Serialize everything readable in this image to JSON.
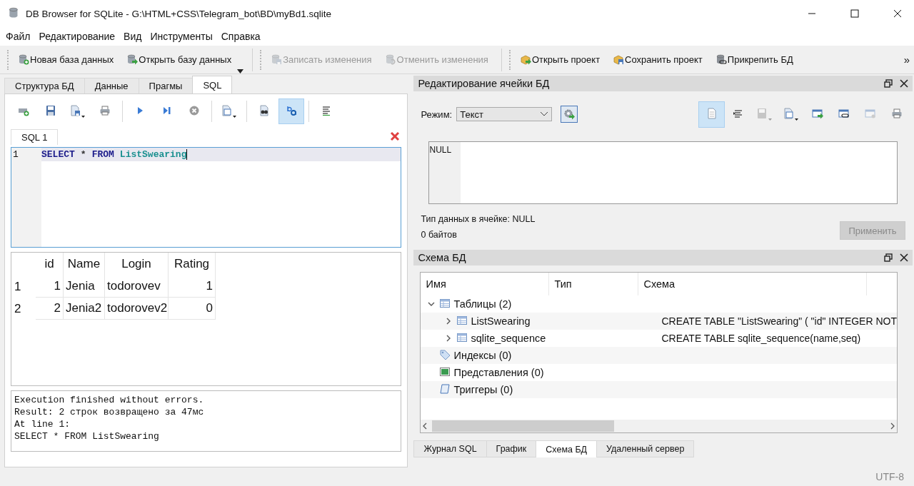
{
  "window": {
    "title": "DB Browser for SQLite - G:\\HTML+CSS\\Telegram_bot\\BD\\myBd1.sqlite"
  },
  "menu": [
    "Файл",
    "Редактирование",
    "Вид",
    "Инструменты",
    "Справка"
  ],
  "toolbar": {
    "buttons": [
      {
        "kind": "db_new",
        "label": "Новая база данных",
        "disabled": false
      },
      {
        "kind": "db_open",
        "label": "Открыть базу данных",
        "disabled": false,
        "dropdown": true
      },
      {
        "kind": "db_write",
        "label": "Записать изменения",
        "disabled": true
      },
      {
        "kind": "db_revert",
        "label": "Отменить изменения",
        "disabled": true
      },
      {
        "kind": "project_open",
        "label": "Открыть проект",
        "disabled": false
      },
      {
        "kind": "project_save",
        "label": "Сохранить проект",
        "disabled": false
      },
      {
        "kind": "db_attach",
        "label": "Прикрепить БД",
        "disabled": false
      }
    ],
    "overflow": "»"
  },
  "left_tabs": [
    {
      "label": "Структура БД",
      "selected": false
    },
    {
      "label": "Данные",
      "selected": false
    },
    {
      "label": "Прагмы",
      "selected": false
    },
    {
      "label": "SQL",
      "selected": true
    }
  ],
  "sql_toolbar": [
    {
      "kind": "tab_new",
      "checked": false
    },
    {
      "kind": "save",
      "checked": false
    },
    {
      "kind": "save_menu",
      "checked": false
    },
    {
      "kind": "print",
      "checked": false
    },
    {
      "kind": "run",
      "checked": false
    },
    {
      "kind": "run_line",
      "checked": false
    },
    {
      "kind": "stop",
      "checked": false
    },
    {
      "kind": "export",
      "checked": false
    },
    {
      "kind": "find",
      "checked": false
    },
    {
      "kind": "replace",
      "checked": true
    },
    {
      "kind": "comment",
      "checked": false
    }
  ],
  "editor_tabs": [
    {
      "label": "SQL 1",
      "selected": true
    }
  ],
  "editor": {
    "lines": [
      {
        "number": "1",
        "tokens": [
          {
            "text": "SELECT",
            "kind": "keyword"
          },
          {
            "text": "*",
            "kind": "operator"
          },
          {
            "text": "FROM",
            "kind": "keyword"
          },
          {
            "text": "ListSwearing",
            "kind": "identifier"
          }
        ]
      }
    ]
  },
  "results": {
    "columns": [
      "id",
      "Name",
      "Login",
      "Rating"
    ],
    "rows": [
      {
        "header": "1",
        "cells": [
          "1",
          "Jenia",
          "todorovev",
          "1"
        ]
      },
      {
        "header": "2",
        "cells": [
          "2",
          "Jenia2",
          "todorovev2",
          "0"
        ]
      }
    ]
  },
  "message": [
    "Execution finished without errors.",
    "Result: 2 строк возвращено за 47мс",
    "At line 1:",
    "SELECT * FROM ListSwearing"
  ],
  "cell_editor": {
    "title": "Редактирование ячейки БД",
    "mode_label": "Режим:",
    "mode_value": "Текст",
    "buttons": [
      {
        "kind": "text",
        "checked": true,
        "disabled": false
      },
      {
        "kind": "indent",
        "checked": false,
        "disabled": false
      },
      {
        "kind": "import",
        "checked": false,
        "disabled": true
      },
      {
        "kind": "export",
        "checked": false,
        "disabled": false
      },
      {
        "kind": "set_as_null",
        "checked": false,
        "disabled": false
      },
      {
        "kind": "link",
        "checked": false,
        "disabled": false
      },
      {
        "kind": "dot",
        "checked": false,
        "disabled": true
      },
      {
        "kind": "print",
        "checked": false,
        "disabled": false
      }
    ],
    "value": "NULL",
    "type_info": "Тип данных в ячейке: NULL",
    "size": "0 байтов",
    "apply": {
      "label": "Применить",
      "disabled": true
    }
  },
  "schema": {
    "title": "Схема БД",
    "columns": [
      "Имя",
      "Тип",
      "Схема"
    ],
    "tree": [
      {
        "kind": "tables",
        "name": "Таблицы (2)",
        "expanded": true,
        "children": [
          {
            "kind": "table",
            "name": "ListSwearing",
            "expanded": false,
            "schema": "CREATE TABLE \"ListSwearing\" ( \"id\" INTEGER NOT"
          },
          {
            "kind": "table",
            "name": "sqlite_sequence",
            "expanded": false,
            "schema": "CREATE TABLE sqlite_sequence(name,seq)"
          }
        ]
      },
      {
        "kind": "indexes",
        "name": "Индексы (0)"
      },
      {
        "kind": "views",
        "name": "Представления (0)"
      },
      {
        "kind": "triggers",
        "name": "Триггеры (0)"
      }
    ]
  },
  "bottom_tabs": [
    {
      "label": "Журнал SQL",
      "selected": false
    },
    {
      "label": "График",
      "selected": false
    },
    {
      "label": "Схема БД",
      "selected": true
    },
    {
      "label": "Удаленный сервер",
      "selected": false
    }
  ],
  "status_bar": {
    "encoding": "UTF-8"
  }
}
